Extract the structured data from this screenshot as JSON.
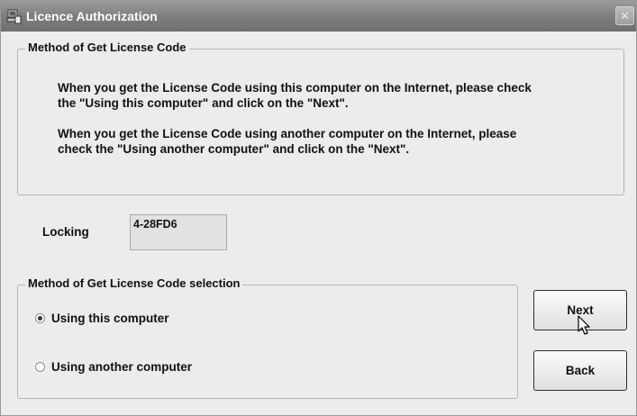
{
  "window": {
    "title": "Licence Authorization",
    "icons": {
      "app": "license-app-icon",
      "close": "close-icon"
    },
    "close_glyph": "×"
  },
  "method_info": {
    "title": "Method of Get License Code",
    "para1_line1": "When you get the License Code using this computer on the Internet, please check",
    "para1_line2": "the \"Using this computer\" and click on the \"Next\".",
    "para2_line1": "When you get the License Code using another computer on the Internet, please",
    "para2_line2": "check the \"Using another computer\" and click on the \"Next\"."
  },
  "locking": {
    "label": "Locking",
    "value": "4-28FD6"
  },
  "selection": {
    "title": "Method of Get License Code selection",
    "options": [
      {
        "label": "Using this computer",
        "selected": true
      },
      {
        "label": "Using another computer",
        "selected": false
      }
    ]
  },
  "buttons": {
    "next": "Next",
    "back": "Back"
  },
  "colors": {
    "titlebar": "#7e7e7e",
    "window_bg": "#ececec"
  }
}
